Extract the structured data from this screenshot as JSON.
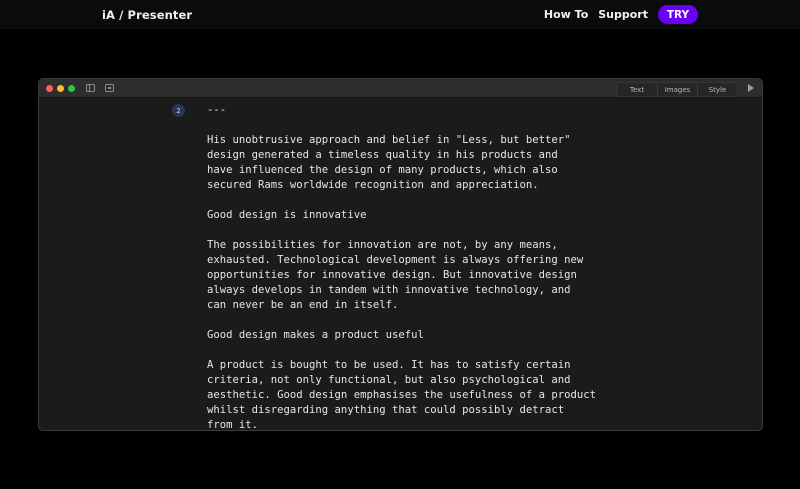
{
  "site": {
    "brand": "iA / Presenter",
    "nav": [
      "How To",
      "Support"
    ],
    "cta": "TRY"
  },
  "window": {
    "tabs": [
      "Text",
      "Images",
      "Style"
    ],
    "slide_number": "2"
  },
  "document": {
    "lines": [
      "---",
      "",
      "His unobtrusive approach and belief in \"Less, but better\"",
      "design generated a timeless quality in his products and",
      "have influenced the design of many products, which also",
      "secured Rams worldwide recognition and appreciation.",
      "",
      "Good design is innovative",
      "",
      "The possibilities for innovation are not, by any means,",
      "exhausted. Technological development is always offering new",
      "opportunities for innovative design. But innovative design",
      "always develops in tandem with innovative technology, and",
      "can never be an end in itself.",
      "",
      "Good design makes a product useful",
      "",
      "A product is bought to be used. It has to satisfy certain",
      "criteria, not only functional, but also psychological and",
      "aesthetic. Good design emphasises the usefulness of a product",
      "whilst disregarding anything that could possibly detract",
      "from it."
    ]
  }
}
